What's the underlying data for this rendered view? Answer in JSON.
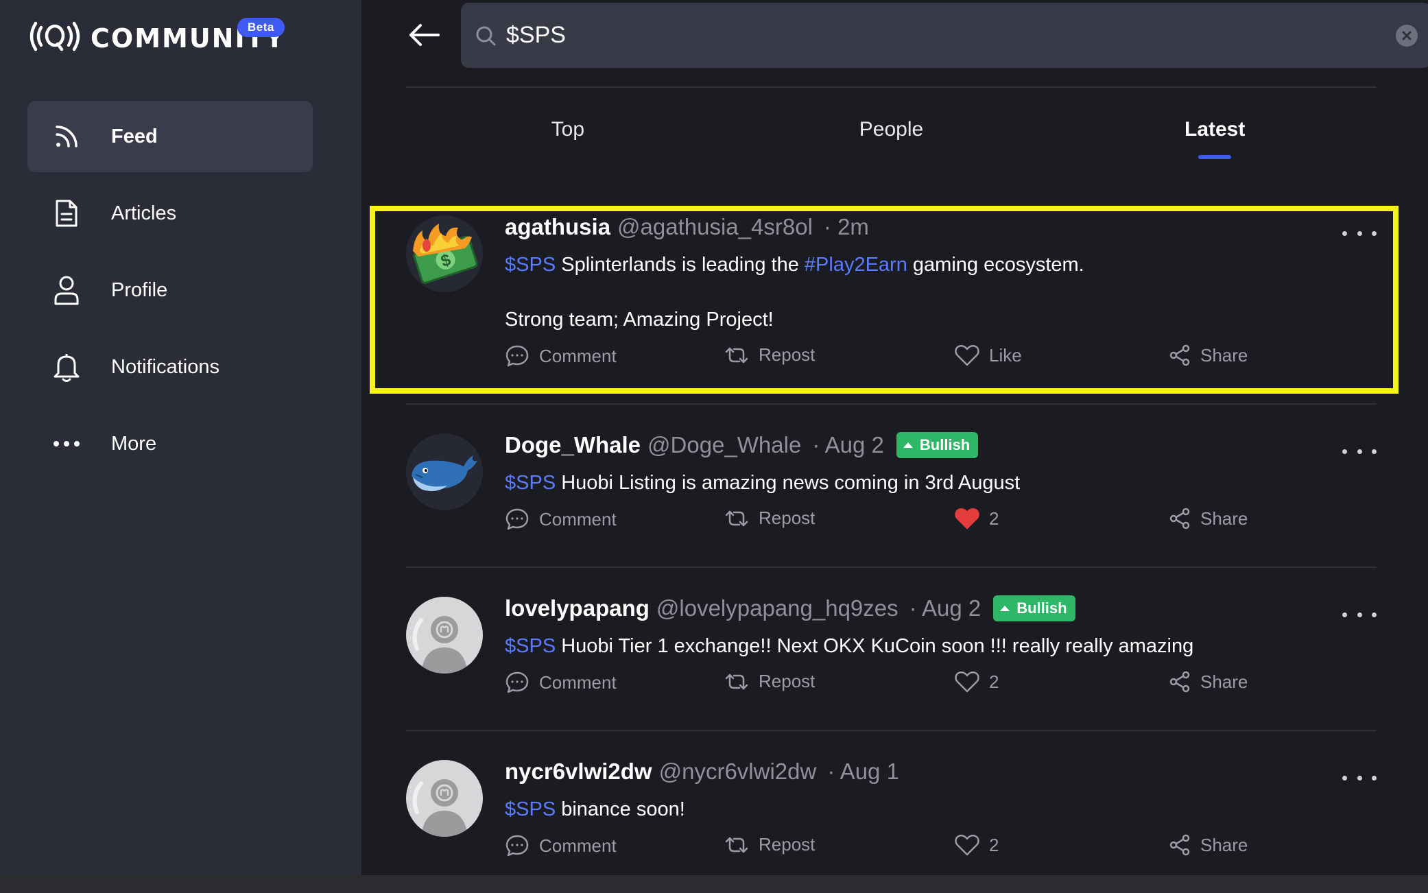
{
  "app": {
    "logo_text": "COMMUNITY",
    "beta_label": "Beta"
  },
  "sidebar": {
    "items": [
      {
        "label": "Feed",
        "icon": "rss-feed-icon",
        "active": true
      },
      {
        "label": "Articles",
        "icon": "document-icon",
        "active": false
      },
      {
        "label": "Profile",
        "icon": "user-icon",
        "active": false
      },
      {
        "label": "Notifications",
        "icon": "bell-icon",
        "active": false
      },
      {
        "label": "More",
        "icon": "ellipsis-icon",
        "active": false
      }
    ]
  },
  "search": {
    "value": "$SPS"
  },
  "tabs": [
    {
      "label": "Top",
      "active": false
    },
    {
      "label": "People",
      "active": false
    },
    {
      "label": "Latest",
      "active": true
    }
  ],
  "posts": [
    {
      "author": "agathusia",
      "handle": "@agathusia_4sr8ol",
      "time": "· 2m",
      "text_parts": [
        "$SPS",
        " Splinterlands is leading the ",
        "#Play2Earn",
        " gaming ecosystem."
      ],
      "text_line2": "Strong team; Amazing Project!",
      "comment": "Comment",
      "repost": "Repost",
      "like": "Like",
      "share": "Share"
    },
    {
      "author": "Doge_Whale",
      "handle": "@Doge_Whale",
      "time": "· Aug 2",
      "badge": "Bullish",
      "text_parts": [
        "$SPS",
        " Huobi Listing is amazing news coming in 3rd August"
      ],
      "comment": "Comment",
      "repost": "Repost",
      "like": "2",
      "liked": true,
      "share": "Share"
    },
    {
      "author": "lovelypapang",
      "handle": "@lovelypapang_hq9zes",
      "time": "· Aug 2",
      "badge": "Bullish",
      "text_parts": [
        "$SPS",
        " Huobi Tier 1 exchange!! Next OKX KuCoin soon !!! really really amazing"
      ],
      "comment": "Comment",
      "repost": "Repost",
      "like": "2",
      "share": "Share"
    },
    {
      "author": "nycr6vlwi2dw",
      "handle": "@nycr6vlwi2dw",
      "time": "· Aug 1",
      "text_parts": [
        "$SPS",
        " binance soon!"
      ],
      "comment": "Comment",
      "repost": "Repost",
      "like": "2",
      "share": "Share"
    }
  ],
  "colors": {
    "accent": "#3e5cf5",
    "tag": "#5b7bff",
    "bullish": "#2fb768",
    "like_active": "#e53d3d",
    "highlight": "#f7f21c",
    "sidebar_bg": "#2a2c38",
    "main_bg": "#1b1c22"
  }
}
